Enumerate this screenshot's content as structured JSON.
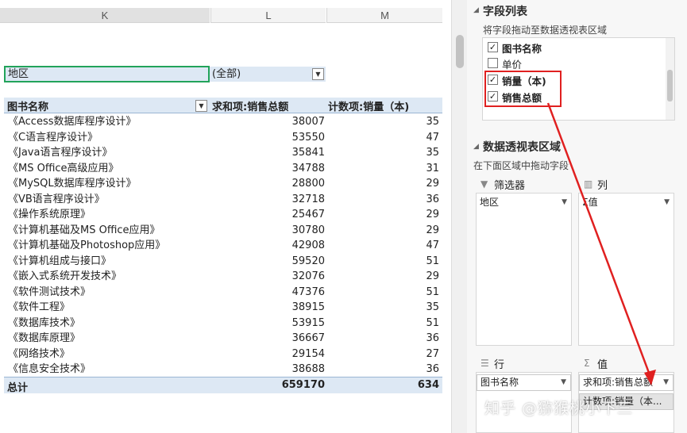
{
  "columns": {
    "k": "K",
    "l": "L",
    "m": "M"
  },
  "filter": {
    "label": "地区",
    "value": "(全部)"
  },
  "pivot": {
    "headers": {
      "name": "图书名称",
      "sum": "求和项:销售总额",
      "count": "计数项:销量（本)"
    },
    "rows": [
      {
        "name": "《Access数据库程序设计》",
        "sum": "38007",
        "count": "35"
      },
      {
        "name": "《C语言程序设计》",
        "sum": "53550",
        "count": "47"
      },
      {
        "name": "《Java语言程序设计》",
        "sum": "35841",
        "count": "35"
      },
      {
        "name": "《MS Office高级应用》",
        "sum": "34788",
        "count": "31"
      },
      {
        "name": "《MySQL数据库程序设计》",
        "sum": "28800",
        "count": "29"
      },
      {
        "name": "《VB语言程序设计》",
        "sum": "32718",
        "count": "36"
      },
      {
        "name": "《操作系统原理》",
        "sum": "25467",
        "count": "29"
      },
      {
        "name": "《计算机基础及MS Office应用》",
        "sum": "30780",
        "count": "29"
      },
      {
        "name": "《计算机基础及Photoshop应用》",
        "sum": "42908",
        "count": "47"
      },
      {
        "name": "《计算机组成与接口》",
        "sum": "59520",
        "count": "51"
      },
      {
        "name": "《嵌入式系统开发技术》",
        "sum": "32076",
        "count": "29"
      },
      {
        "name": "《软件测试技术》",
        "sum": "47376",
        "count": "51"
      },
      {
        "name": "《软件工程》",
        "sum": "38915",
        "count": "35"
      },
      {
        "name": "《数据库技术》",
        "sum": "53915",
        "count": "51"
      },
      {
        "name": "《数据库原理》",
        "sum": "36667",
        "count": "36"
      },
      {
        "name": "《网络技术》",
        "sum": "29154",
        "count": "27"
      },
      {
        "name": "《信息安全技术》",
        "sum": "38688",
        "count": "36"
      }
    ],
    "total": {
      "label": "总计",
      "sum": "659170",
      "count": "634"
    }
  },
  "pane": {
    "field_list_title": "字段列表",
    "field_list_hint": "将字段拖动至数据透视表区域",
    "fields": [
      {
        "label": "图书名称",
        "checked": true
      },
      {
        "label": "单价",
        "checked": false
      },
      {
        "label": "销量（本)",
        "checked": true
      },
      {
        "label": "销售总额",
        "checked": true
      }
    ],
    "areas_title": "数据透视表区域",
    "areas_hint": "在下面区域中拖动字段",
    "filters_label": "筛选器",
    "columns_label": "列",
    "rows_label": "行",
    "values_label": "值",
    "filter_chip": "地区",
    "column_chip": "Σ值",
    "row_chip": "图书名称",
    "value_chip_1": "求和项:销售总额",
    "value_chip_2": "计数项:销量（本..."
  },
  "watermark": "知乎 @猕猴桃小下三",
  "accent_colors": {
    "selection": "#22a35a",
    "pivot_band": "#dde8f4",
    "annotation": "#e02020"
  }
}
